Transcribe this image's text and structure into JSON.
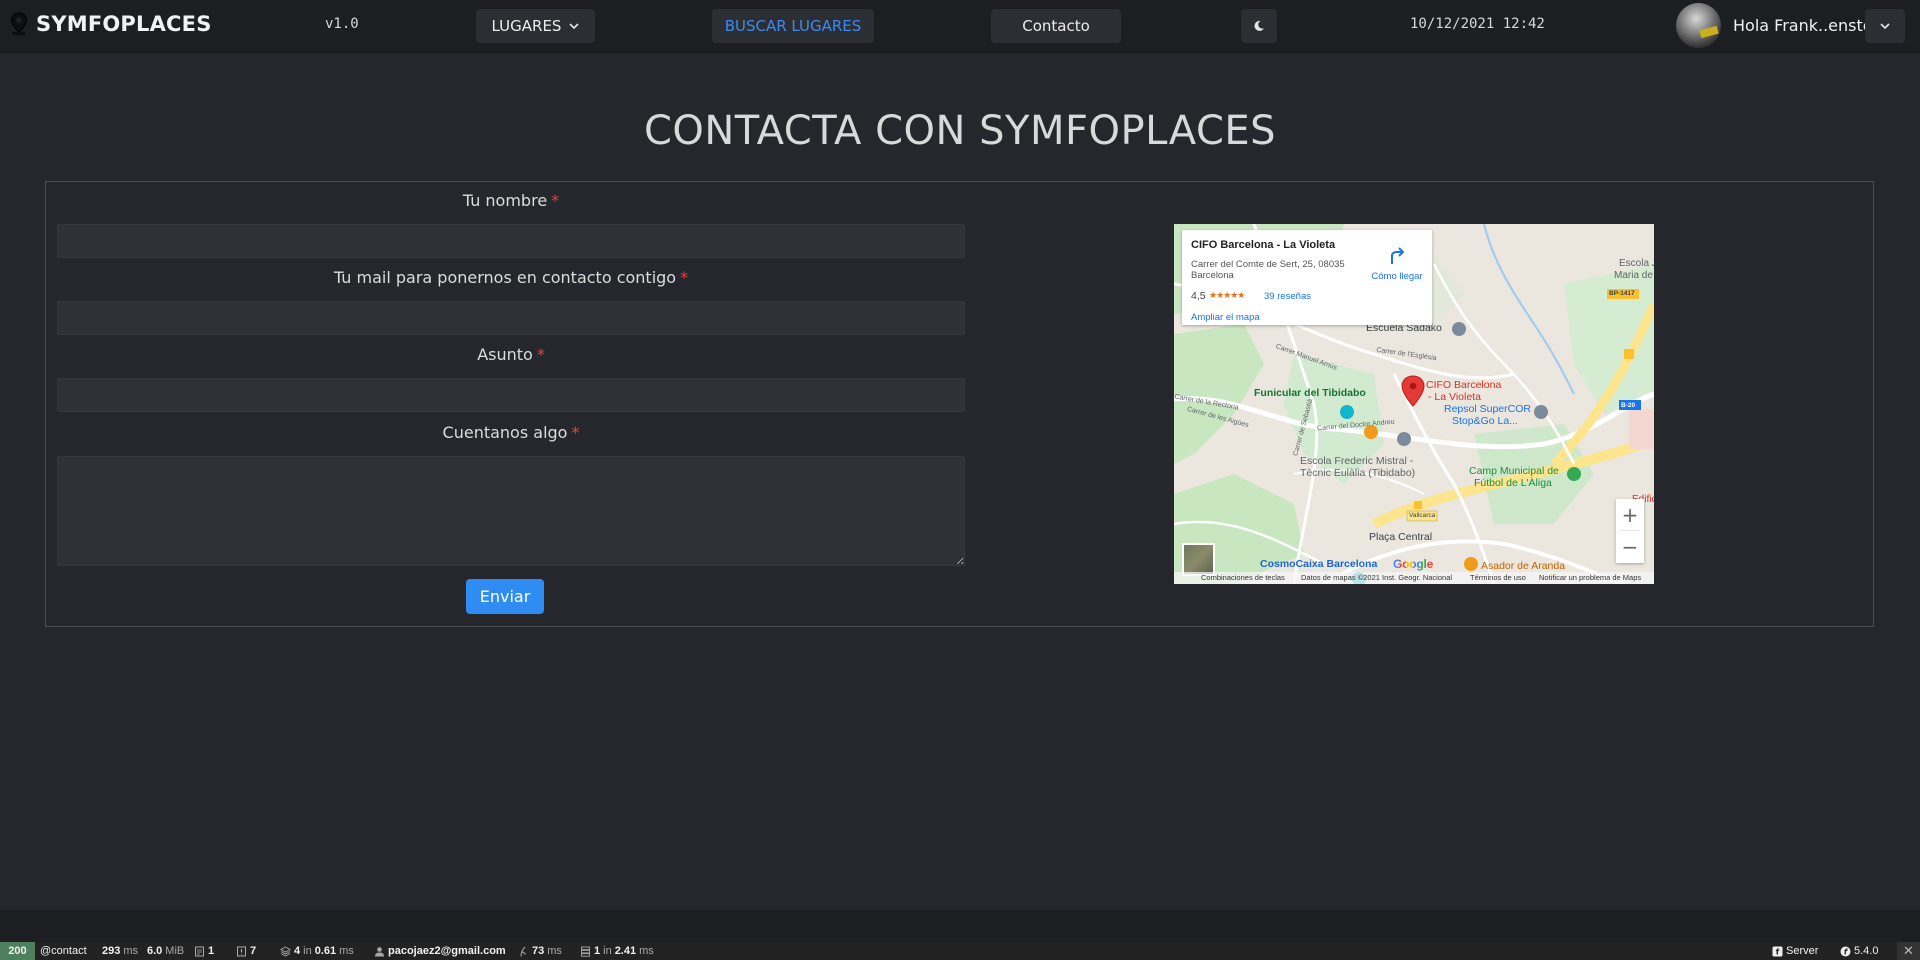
{
  "navbar": {
    "brand": "SYMFOPLACES",
    "version": "v1.0",
    "lugares_label": "LUGARES",
    "buscar_label": "BUSCAR LUGARES",
    "contacto_label": "Contacto",
    "datetime": "10/12/2021 12:42",
    "greeting": "Hola Frank..enstein",
    "accent_color": "#3a8bf5"
  },
  "main": {
    "title": "CONTACTA CON SYMFOPLACES",
    "form": {
      "name_label": "Tu nombre",
      "email_label": "Tu mail para ponernos en contacto contigo",
      "subject_label": "Asunto",
      "message_label": "Cuentanos algo",
      "required_mark": "*",
      "name_value": "",
      "email_value": "",
      "subject_value": "",
      "message_value": "",
      "submit_label": "Enviar"
    }
  },
  "map": {
    "card": {
      "title": "CIFO Barcelona - La Violeta",
      "address": "Carrer del Comte de Sert, 25, 08035 Barcelona",
      "rating": "4,5",
      "stars": "★★★★★",
      "reviews": "39 reseñas",
      "enlarge": "Ampliar el mapa",
      "directions": "Cómo llegar"
    },
    "labels": {
      "escola_sadako": "Escuela Sadako",
      "escola_jo": "Escola Jo",
      "maria_sa": "Maria de Sag",
      "bp1417": "BP-1417",
      "b20": "B-20",
      "carrer_manuel": "Carrer Manuel Arnús",
      "carrer_esglesia": "Carrer de l'Església",
      "funicular": "Funicular del Tibidabo",
      "pin_label_1": "CIFO Barcelona",
      "pin_label_2": "- La Violeta",
      "repsol_1": "Repsol SuperCOR",
      "repsol_2": "Stop&Go La...",
      "escola_mistral_1": "Escola Frederic Mistral -",
      "escola_mistral_2": "Tècnic Eulàlia (Tibidabo)",
      "camp_1": "Camp Municipal de",
      "camp_2": "Fútbol de L'Àliga",
      "placa_central": "Plaça Central",
      "cosmocaixa": "CosmoCaixa Barcelona",
      "asador": "Asador de Aranda",
      "vallcarca": "Vallcarca",
      "edifici": "Edific",
      "carrer_andreu": "Carrer del Doctor Andreu",
      "carrer_rectoria": "Carrer de la Rectoria",
      "carrer_aigues": "Carrer de les Aigües",
      "carrer_sebastia": "Carrer de Sebastià",
      "google": "Google"
    },
    "footer": {
      "shortcuts": "Combinaciones de teclas",
      "data": "Datos de mapas ©2021 Inst. Geogr. Nacional",
      "terms": "Términos de uso",
      "report": "Notificar un problema de Maps"
    },
    "zoom_in": "+",
    "zoom_out": "−"
  },
  "toolbar": {
    "status": "200",
    "route": "@contact",
    "time_value": "293",
    "time_unit": "ms",
    "memory_value": "6.0",
    "memory_unit": "MiB",
    "forms": "1",
    "validator": "7",
    "cache_calls": "4",
    "cache_in": "in",
    "cache_time": "0.61",
    "cache_unit": "ms",
    "user": "pacojaez2@gmail.com",
    "twig_value": "73",
    "twig_unit": "ms",
    "db_queries": "1",
    "db_in": "in",
    "db_time": "2.41",
    "db_unit": "ms",
    "server_label": "Server",
    "symfony_version": "5.4.0",
    "close": "✕"
  }
}
